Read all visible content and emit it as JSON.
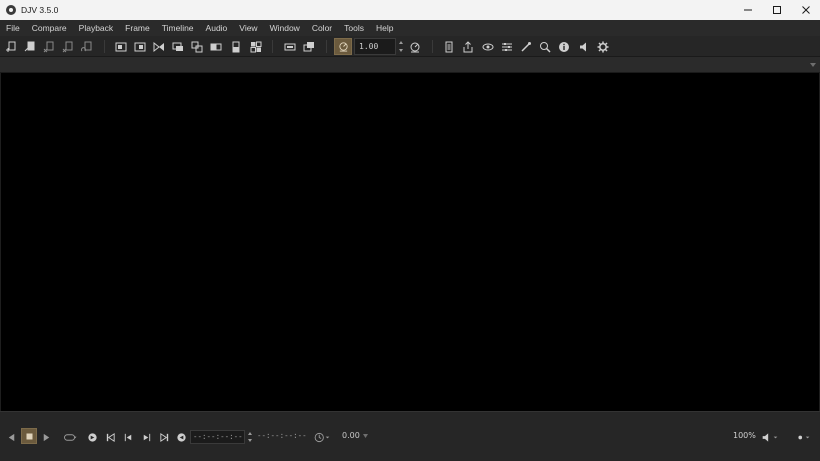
{
  "window": {
    "title": "DJV 3.5.0"
  },
  "menu": [
    "File",
    "Compare",
    "Playback",
    "Frame",
    "Timeline",
    "Audio",
    "View",
    "Window",
    "Color",
    "Tools",
    "Help"
  ],
  "toolbar": {
    "speed_value": "1.00"
  },
  "playbar": {
    "current_time": "--:--:--:--",
    "duration": "--:--:--:--",
    "fps": "0.00",
    "volume": "100%"
  },
  "colors": {
    "accent": "#6b5a3d",
    "background": "#1e1e1e",
    "viewport": "#000000"
  },
  "icons": {
    "file": [
      "file-open-icon",
      "file-close-icon",
      "file-close-all-icon",
      "file-next-icon",
      "file-reload-icon"
    ],
    "compare": [
      "compare-a-icon",
      "compare-b-icon",
      "compare-wipe-icon",
      "compare-overlay-icon",
      "compare-difference-icon",
      "compare-horizontal-icon",
      "compare-vertical-icon",
      "compare-tile-icon"
    ],
    "window": [
      "full-screen-icon",
      "float-on-top-icon"
    ],
    "speed": [
      "speed-toggle-icon",
      "speed-reset-icon"
    ],
    "tools": [
      "files-icon",
      "export-icon",
      "view-icon",
      "color-icon",
      "color-picker-icon",
      "magnify-icon",
      "info-icon",
      "audio-icon",
      "settings-icon"
    ]
  }
}
